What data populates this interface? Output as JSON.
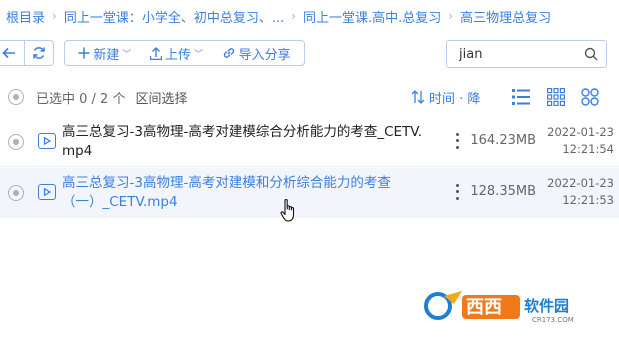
{
  "breadcrumb": [
    {
      "label": "根目录"
    },
    {
      "label": "同上一堂课：小学全、初中总复习、..."
    },
    {
      "label": "同上一堂课.高中.总复习"
    },
    {
      "label": "高三物理总复习"
    }
  ],
  "toolbar": {
    "new_label": "新建",
    "upload_label": "上传",
    "share_label": "导入分享"
  },
  "search": {
    "value": "jian"
  },
  "selection": {
    "info": "已选中 0 / 2 个",
    "range_label": "区间选择"
  },
  "sort": {
    "label": "时间 · 降"
  },
  "files": [
    {
      "name_line1": "高三总复习-3高物理-高考对建模综合分析能力的考查_CETV.",
      "name_line2": "mp4",
      "size": "164.23MB",
      "date": "2022-01-23",
      "time": "12:21:54"
    },
    {
      "name_line1": "高三总复习-3高物理-高考对建模和分析综合能力的考查",
      "name_line2": "（一）_CETV.mp4",
      "size": "128.35MB",
      "date": "2022-01-23",
      "time": "12:21:53"
    }
  ],
  "watermark": {
    "brand": "西西软件园",
    "domain": "CR173.COM"
  },
  "colors": {
    "accent": "#3b7fe0",
    "hover_row": "#f2f5fb",
    "border": "#b8cdf0"
  },
  "icons": [
    "back-arrow-icon",
    "refresh-icon",
    "plus-icon",
    "upload-icon",
    "link-icon",
    "search-icon",
    "sort-icon",
    "list-view-icon",
    "grid-view-icon",
    "large-grid-view-icon",
    "video-file-icon",
    "more-icon",
    "hand-cursor-icon"
  ]
}
